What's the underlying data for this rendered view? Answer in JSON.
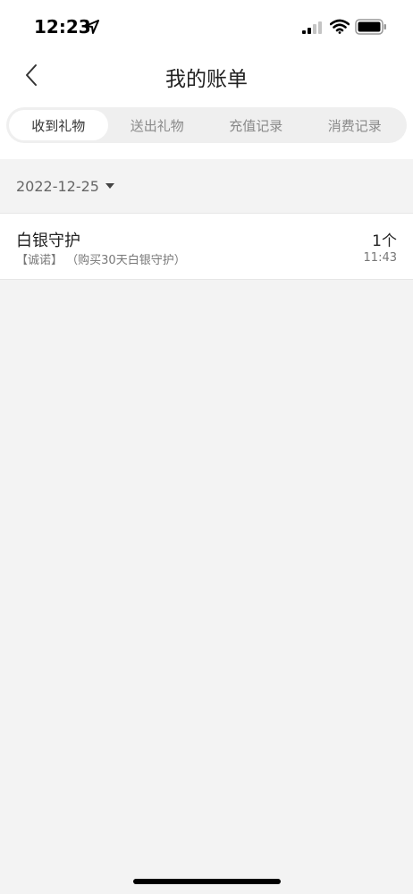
{
  "status_bar": {
    "time": "12:23"
  },
  "nav": {
    "title": "我的账单"
  },
  "tabs": [
    {
      "label": "收到礼物",
      "active": true
    },
    {
      "label": "送出礼物",
      "active": false
    },
    {
      "label": "充值记录",
      "active": false
    },
    {
      "label": "消费记录",
      "active": false
    }
  ],
  "filter": {
    "date": "2022-12-25"
  },
  "records": [
    {
      "title": "白银守护",
      "sender": "【诚诺】",
      "detail": "（购买30天白银守护）",
      "quantity": "1个",
      "time": "11:43"
    }
  ]
}
